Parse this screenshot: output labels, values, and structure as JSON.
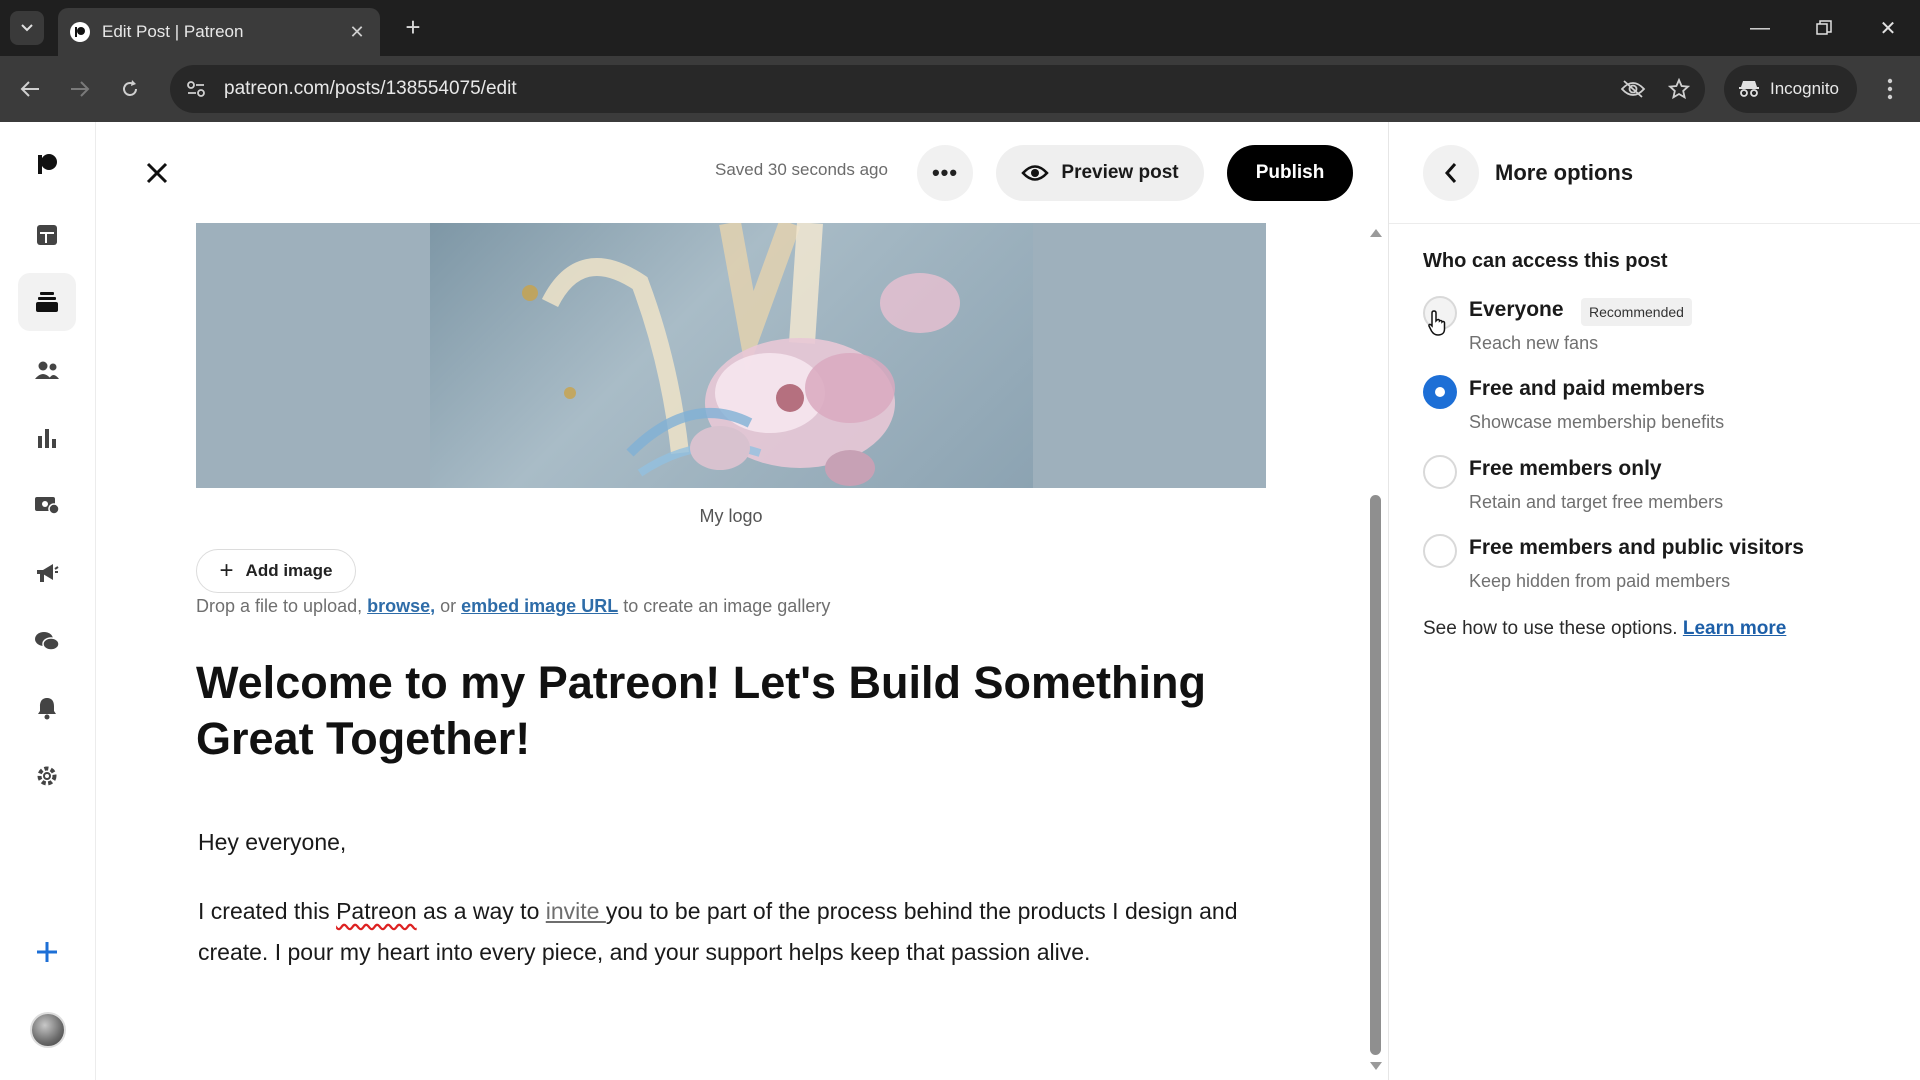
{
  "browser": {
    "tab_title": "Edit Post | Patreon",
    "url": "patreon.com/posts/138554075/edit",
    "incognito_label": "Incognito"
  },
  "icons": {
    "tab_search": "chevron-down-icon",
    "favicon": "patreon-logo-icon",
    "back": "arrow-left-icon",
    "forward": "arrow-right-icon",
    "reload": "reload-icon",
    "eye_off": "eye-off-icon",
    "star": "star-icon",
    "rail": [
      "patreon-logo-icon",
      "dashboard-icon",
      "library-icon",
      "audience-icon",
      "insights-icon",
      "payouts-icon",
      "promotions-icon",
      "chats-icon",
      "notifications-icon",
      "settings-icon",
      "plus-icon"
    ]
  },
  "editor": {
    "saved_status": "Saved 30 seconds ago",
    "more_label": "•••",
    "preview_label": "Preview post",
    "publish_label": "Publish",
    "image_caption": "My logo",
    "add_image_label": "Add image",
    "drop_text_before": "Drop a file to upload, ",
    "browse_label": "browse,",
    "drop_text_mid": " or ",
    "embed_label": "embed image URL",
    "drop_text_after": " to create an image gallery",
    "title": "Welcome to my Patreon! Let's Build Something Great Together!",
    "greeting": "Hey everyone,",
    "body_p1": "I created this ",
    "body_spell": "Patreon",
    "body_p2": " as a way to ",
    "body_link": "invite ",
    "body_p3": "you to be part of the process behind the products I design and create. I pour my heart into every piece, and your support helps keep that passion alive."
  },
  "panel": {
    "title": "More options",
    "access_heading": "Who can access this post",
    "options": [
      {
        "label": "Everyone",
        "badge": "Recommended",
        "desc": "Reach new fans",
        "selected": false
      },
      {
        "label": "Free and paid members",
        "desc": "Showcase membership benefits",
        "selected": true
      },
      {
        "label": "Free members only",
        "desc": "Retain and target free members",
        "selected": false
      },
      {
        "label": "Free members and public visitors",
        "desc": "Keep hidden from paid members",
        "selected": false
      }
    ],
    "learn_text": "See how to use these options. ",
    "learn_link": "Learn more"
  },
  "colors": {
    "accent": "#1d6fd6",
    "publish_bg": "#000000",
    "link": "#2e6ca8"
  }
}
